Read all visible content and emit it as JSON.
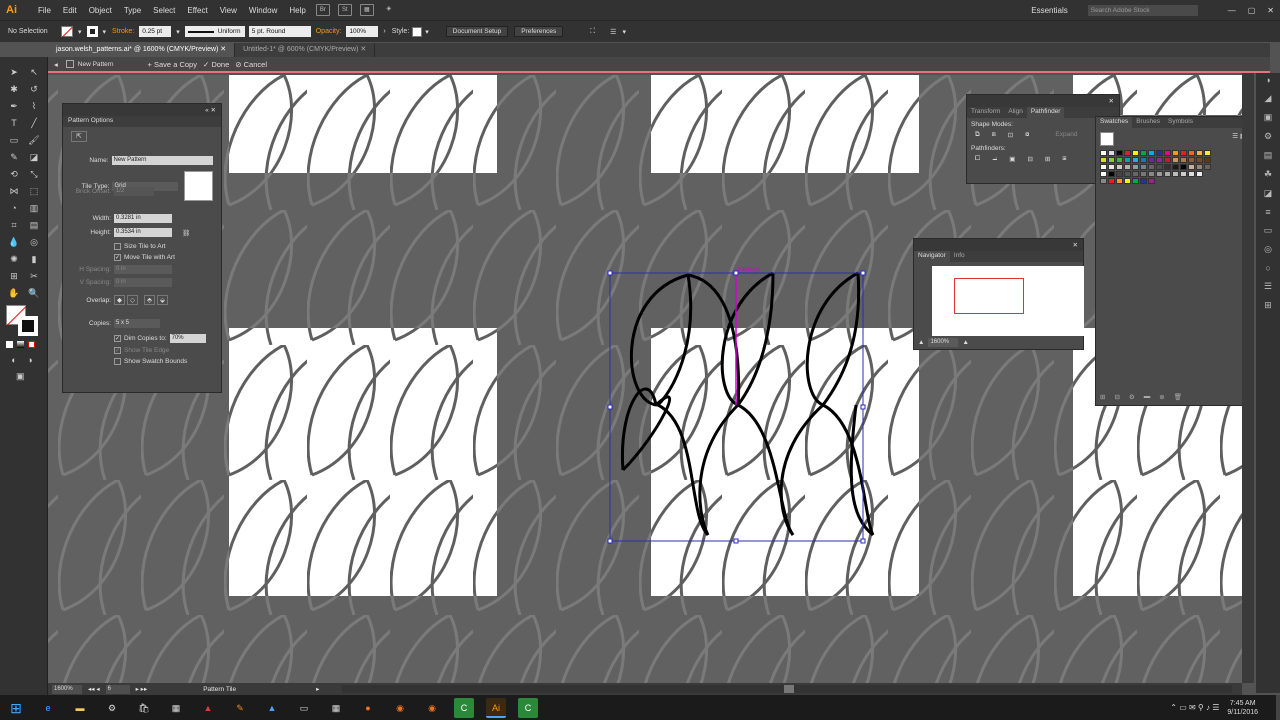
{
  "app": {
    "logo": "Ai"
  },
  "menu": [
    "File",
    "Edit",
    "Object",
    "Type",
    "Select",
    "Effect",
    "View",
    "Window",
    "Help"
  ],
  "workspace": "Essentials",
  "search_placeholder": "Search Adobe Stock",
  "control": {
    "selection": "No Selection",
    "stroke_label": "Stroke:",
    "stroke_weight": "0.25 pt",
    "profile": "Uniform",
    "brush": "5 pt. Round",
    "opacity_label": "Opacity:",
    "opacity": "100%",
    "style_label": "Style:",
    "doc_setup": "Document Setup",
    "preferences": "Preferences"
  },
  "tabs": [
    {
      "label": "jason.welsh_patterns.ai* @ 1600% (CMYK/Preview)"
    },
    {
      "label": "Untitled-1* @ 600% (CMYK/Preview)"
    }
  ],
  "isolation": {
    "name": "New Pattern",
    "save_copy": "+ Save a Copy",
    "done": "✓ Done",
    "cancel": "⊘ Cancel"
  },
  "pattern_options": {
    "title": "Pattern Options",
    "name_label": "Name:",
    "name": "New Pattern",
    "tile_type_label": "Tile Type:",
    "tile_type": "Grid",
    "brick_offset_label": "Brick Offset:",
    "brick_offset": "1/2",
    "width_label": "Width:",
    "width": "0.3281 in",
    "height_label": "Height:",
    "height": "0.3534 in",
    "size_tile": "Size Tile to Art",
    "move_tile": "Move Tile with Art",
    "hspacing_label": "H Spacing:",
    "hspacing": "0 in",
    "vspacing_label": "V Spacing:",
    "vspacing": "0 in",
    "overlap_label": "Overlap:",
    "copies_label": "Copies:",
    "copies": "5 x 5",
    "dim_copies": "Dim Copies to:",
    "dim_value": "70%",
    "show_tile_edge": "Show Tile Edge",
    "show_swatch_bounds": "Show Swatch Bounds"
  },
  "pathfinder": {
    "tabs": [
      "Transform",
      "Align",
      "Pathfinder"
    ],
    "shape_modes": "Shape Modes:",
    "pathfinders": "Pathfinders:",
    "expand": "Expand"
  },
  "swatches": {
    "tabs": [
      "Swatches",
      "Brushes",
      "Symbols"
    ]
  },
  "navigator": {
    "tabs": [
      "Navigator",
      "Info"
    ],
    "zoom": "1600%"
  },
  "canvas": {
    "anchor_label": "intersect"
  },
  "status": {
    "zoom": "1600%",
    "artboard": "6",
    "tool": "Pattern Tile"
  },
  "taskbar": {
    "time": "7:45 AM",
    "date": "9/11/2016"
  },
  "colors": {
    "accent": "#f29421",
    "isolation_line": "#e8747a",
    "selection": "#2b2bb8",
    "magenta": "#d400d4"
  }
}
